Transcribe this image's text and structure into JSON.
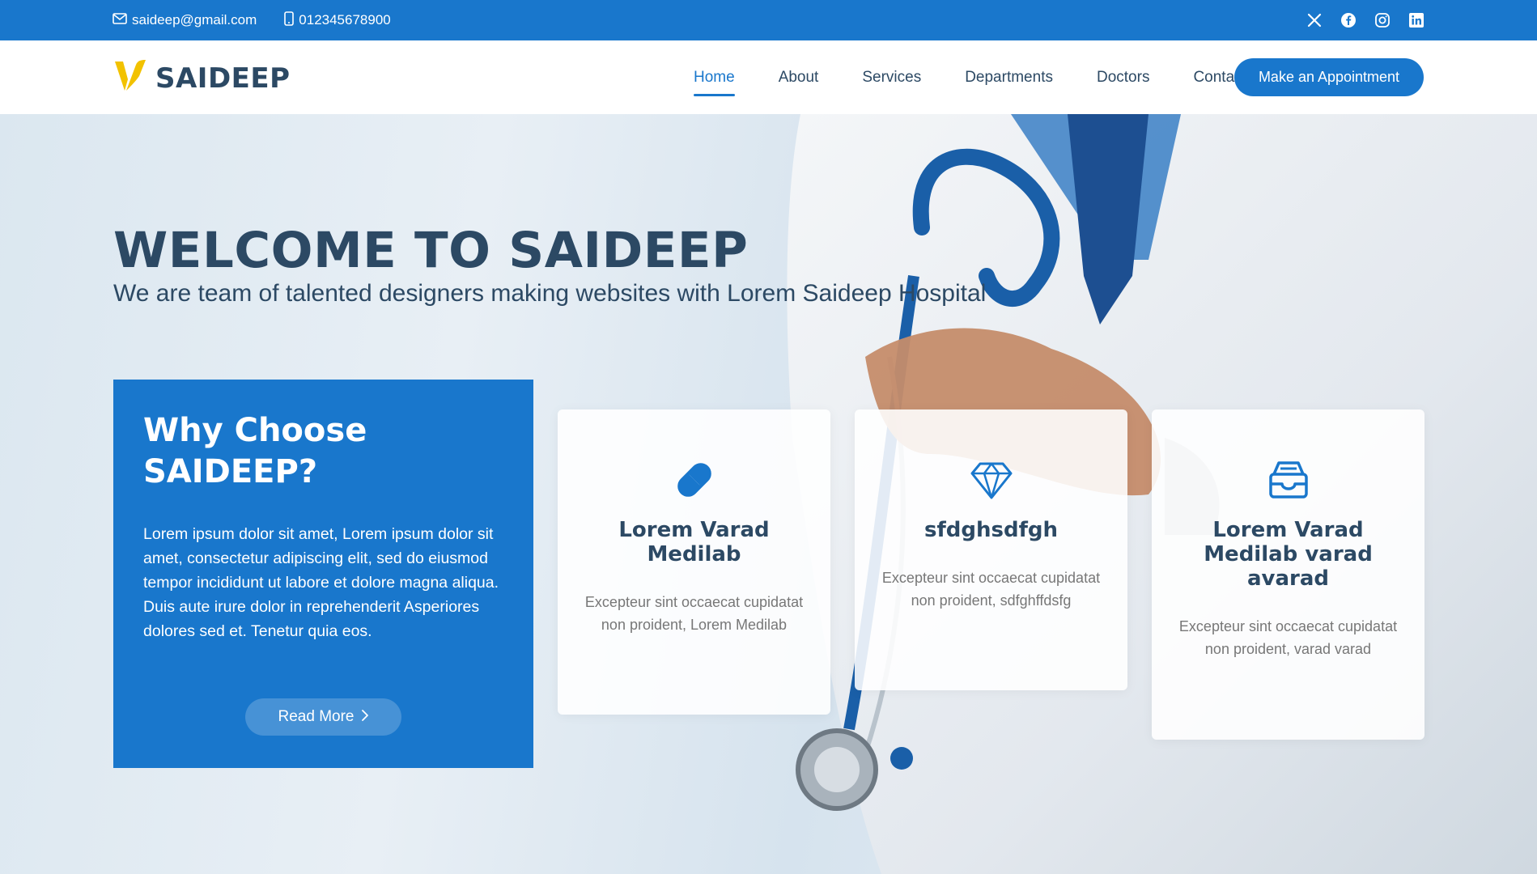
{
  "topbar": {
    "email": "saideep@gmail.com",
    "phone": "012345678900",
    "social_icons": [
      "x-icon",
      "facebook-icon",
      "instagram-icon",
      "linkedin-icon"
    ]
  },
  "header": {
    "logo_text": "SAIDEEP",
    "nav": [
      "Home",
      "About",
      "Services",
      "Departments",
      "Doctors",
      "Contact"
    ],
    "active_nav": "Home",
    "appointment_label": "Make an Appointment"
  },
  "hero": {
    "title": "WELCOME TO SAIDEEP",
    "subtitle": "We are team of talented designers making websites with Lorem Saideep Hospital"
  },
  "why": {
    "title": "Why Choose SAIDEEP?",
    "body": "Lorem ipsum dolor sit amet, Lorem ipsum dolor sit amet, consectetur adipiscing elit, sed do eiusmod tempor incididunt ut labore et dolore magna aliqua. Duis aute irure dolor in reprehenderit Asperiores dolores sed et. Tenetur quia eos.",
    "button": "Read More"
  },
  "cards": [
    {
      "icon": "capsule-icon",
      "title": "Lorem Varad Medilab",
      "text": "Excepteur sint occaecat cupidatat non proident, Lorem Medilab"
    },
    {
      "icon": "gem-icon",
      "title": "sfdghsdfgh",
      "text": "Excepteur sint occaecat cupidatat non proident, sdfghffdsfg"
    },
    {
      "icon": "inbox-icon",
      "title": "Lorem Varad Medilab varad avarad",
      "text": "Excepteur sint occaecat cupidatat non proident, varad varad"
    }
  ],
  "colors": {
    "primary": "#1977cc",
    "heading": "#2c4964",
    "logo_accent": "#f2c200"
  }
}
